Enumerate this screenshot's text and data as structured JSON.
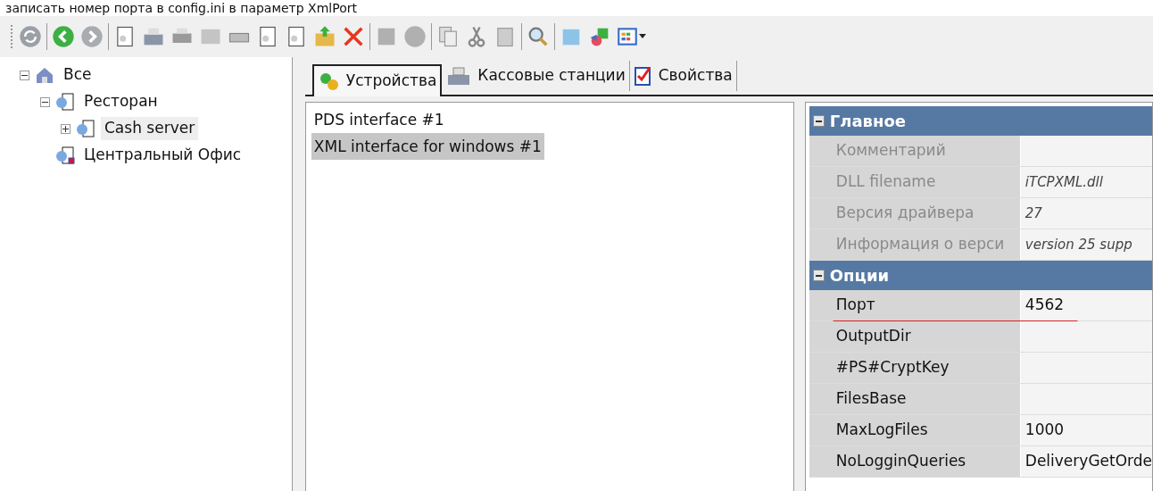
{
  "caption": "записать номер порта в config.ini в параметр XmlPort",
  "tree": [
    {
      "label": "Все",
      "kind": "house",
      "expanded": true,
      "selected": false,
      "children": [
        {
          "label": "Ресторан",
          "kind": "node",
          "expanded": true,
          "selected": false,
          "children": [
            {
              "label": "Cash server",
              "kind": "node",
              "expanded": false,
              "selected": true
            }
          ]
        },
        {
          "label": "Центральный Офис",
          "kind": "office",
          "selected": false
        }
      ]
    }
  ],
  "tabs": [
    {
      "label": "Устройства",
      "kind": "gears",
      "selected": true
    },
    {
      "label": "Кассовые станции",
      "kind": "register",
      "selected": false
    },
    {
      "label": "Свойства",
      "kind": "check",
      "selected": false
    }
  ],
  "devices": [
    {
      "label": "PDS interface #1",
      "selected": false
    },
    {
      "label": "XML interface for windows #1",
      "selected": true
    }
  ],
  "properties": [
    {
      "title": "Главное",
      "expanded": true,
      "rows": [
        {
          "name": "Комментарий",
          "disabled": true
        },
        {
          "name": "DLL filename",
          "value": "iTCPXML.dll",
          "disabled": true
        },
        {
          "name": "Версия драйвера",
          "value": "27",
          "disabled": true
        },
        {
          "name": "Информация о верси",
          "value": "version 25 supp",
          "disabled": true
        }
      ]
    },
    {
      "title": "Опции",
      "expanded": true,
      "rows": [
        {
          "name": "Порт",
          "value": "4562",
          "disabled": false,
          "underlined": true
        },
        {
          "name": "OutputDir",
          "disabled": false
        },
        {
          "name": "#PS#CryptKey",
          "disabled": false
        },
        {
          "name": "FilesBase",
          "disabled": false
        },
        {
          "name": "MaxLogFiles",
          "value": "1000",
          "disabled": false
        },
        {
          "name": "NoLogginQueries",
          "value": "DeliveryGetOrde",
          "disabled": false
        }
      ]
    }
  ]
}
